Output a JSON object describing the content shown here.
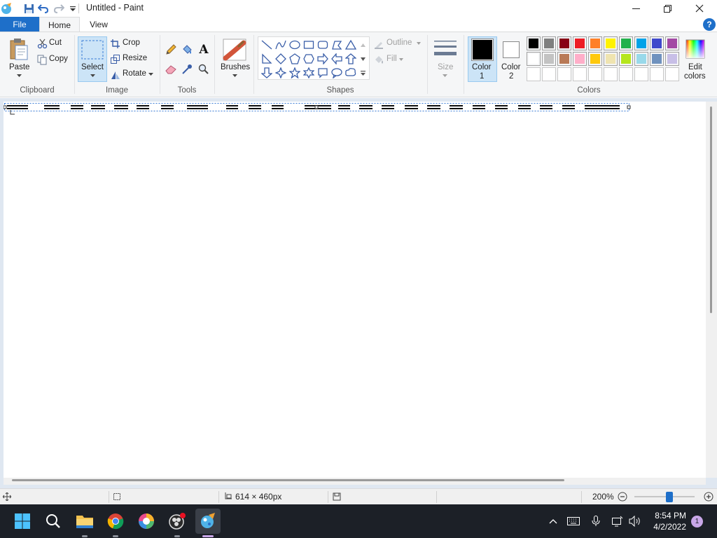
{
  "window": {
    "title": "Untitled - Paint"
  },
  "tabs": {
    "file": "File",
    "home": "Home",
    "view": "View",
    "help": "?"
  },
  "clipboard": {
    "paste": "Paste",
    "cut": "Cut",
    "copy": "Copy",
    "label": "Clipboard"
  },
  "image": {
    "select": "Select",
    "crop": "Crop",
    "resize": "Resize",
    "rotate": "Rotate",
    "label": "Image"
  },
  "tools": {
    "label": "Tools",
    "text_glyph": "A"
  },
  "brushes": {
    "label": "Brushes"
  },
  "shapes": {
    "outline": "Outline",
    "fill": "Fill",
    "label": "Shapes"
  },
  "size": {
    "label": "Size"
  },
  "colors": {
    "color1": "Color",
    "color1_num": "1",
    "color2": "Color",
    "color2_num": "2",
    "edit_line1": "Edit",
    "edit_line2": "colors",
    "label": "Colors",
    "color1_value": "#000000",
    "color2_value": "#ffffff",
    "palette_row1": [
      "#000000",
      "#7f7f7f",
      "#880015",
      "#ed1c24",
      "#ff7f27",
      "#fff200",
      "#22b14c",
      "#00a2e8",
      "#3f48cc",
      "#a349a4"
    ],
    "palette_row2": [
      "#ffffff",
      "#c3c3c3",
      "#b97a57",
      "#ffaec9",
      "#ffc90e",
      "#efe4b0",
      "#b5e61d",
      "#99d9ea",
      "#7092be",
      "#c8bfe7"
    ],
    "palette_row3": [
      "#ffffff",
      "#ffffff",
      "#ffffff",
      "#ffffff",
      "#ffffff",
      "#ffffff",
      "#ffffff",
      "#ffffff",
      "#ffffff",
      "#ffffff"
    ]
  },
  "status": {
    "dimensions": "614 × 460px",
    "zoom": "200%"
  },
  "taskbar": {
    "time": "8:54 PM",
    "date": "4/2/2022",
    "notifications": "1"
  }
}
